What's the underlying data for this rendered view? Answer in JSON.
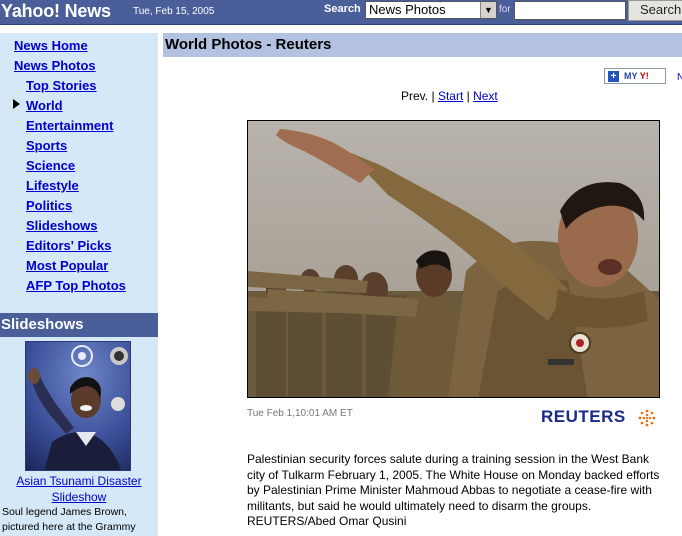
{
  "header": {
    "brand": "Yahoo! News",
    "date": "Tue, Feb 15, 2005",
    "search_label": "Search",
    "search_scope": "News Photos",
    "for_label": "for",
    "search_value": "",
    "search_button": "Search"
  },
  "nav": {
    "items": [
      {
        "label": "News Home"
      },
      {
        "label": "News Photos"
      },
      {
        "label": "Top Stories"
      },
      {
        "label": "World"
      },
      {
        "label": "Entertainment"
      },
      {
        "label": "Sports"
      },
      {
        "label": "Science"
      },
      {
        "label": "Lifestyle"
      },
      {
        "label": "Politics"
      },
      {
        "label": "Slideshows"
      },
      {
        "label": "Editors' Picks"
      },
      {
        "label": "Most Popular"
      },
      {
        "label": "AFP Top Photos"
      }
    ],
    "current": "World"
  },
  "slideshows": {
    "title": "Slideshows",
    "link_label": "Asian Tsunami Disaster Slideshow",
    "description": "Soul legend James Brown, pictured here at the Grammy"
  },
  "main": {
    "title": "World Photos - Reuters",
    "my_yahoo_label": "MY",
    "my_yahoo_brand": "Y!",
    "pager": {
      "prev": "Prev.",
      "sep1": "|",
      "start": "Start",
      "sep2": "|",
      "next": "Next"
    },
    "photo_timestamp": "Tue Feb 1,10:01 AM ET",
    "credit_logo": "REUTERS",
    "caption": "Palestinian security forces salute during a training session in the West Bank city of Tulkarm February 1, 2005. The White House on Monday backed efforts by Palestinian Prime Minister Mahmoud Abbas to negotiate a cease-fire with militants, but said he would ultimately need to disarm the groups. REUTERS/Abed Omar Qusini"
  },
  "colors": {
    "topbar": "#4a5e9a",
    "nav_bg": "#d4e8f7",
    "main_header": "#b3c2e0",
    "link": "#0000cc",
    "reuters": "#1a2a8a"
  }
}
